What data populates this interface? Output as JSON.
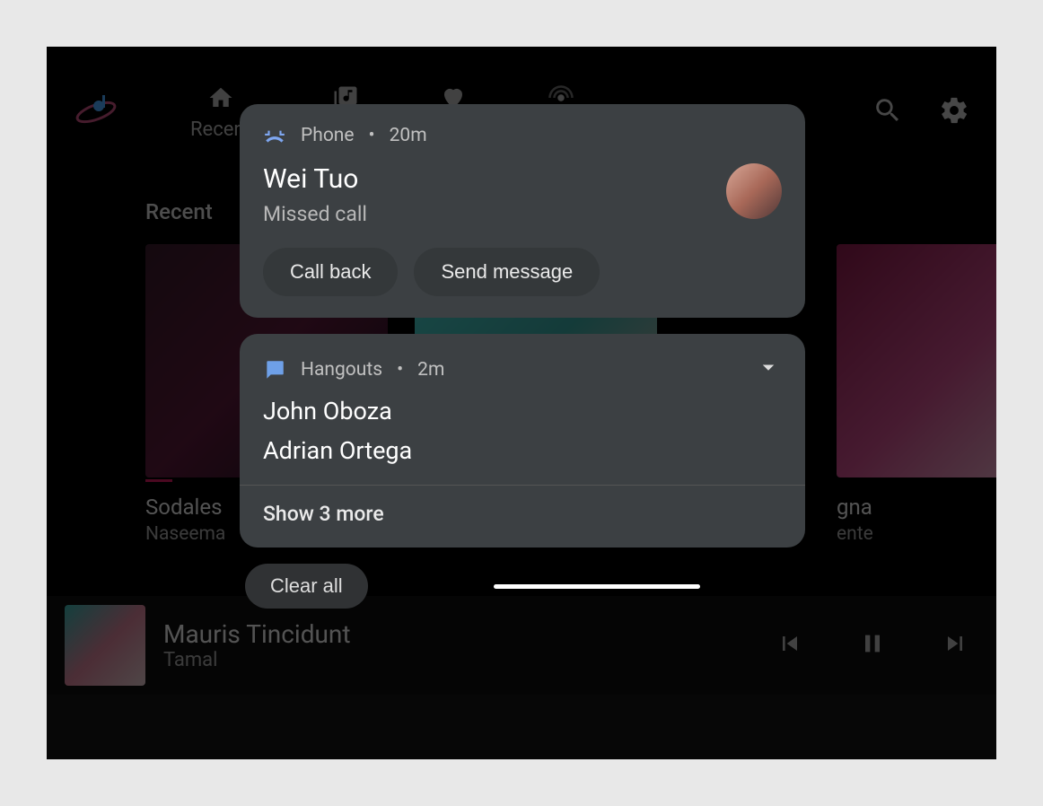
{
  "nav": {
    "tab_recent": "Recent"
  },
  "section": {
    "recent_title": "Recent"
  },
  "cards": [
    {
      "title": "Sodales",
      "subtitle": "Naseema"
    },
    {
      "title": "",
      "subtitle": ""
    },
    {
      "title": "gna",
      "subtitle": "ente"
    }
  ],
  "player": {
    "title": "Mauris Tincidunt",
    "subtitle": "Tamal"
  },
  "notifications": {
    "phone": {
      "app_label": "Phone",
      "time": "20m",
      "title": "Wei Tuo",
      "subtitle": "Missed call",
      "action_callback": "Call back",
      "action_message": "Send message"
    },
    "hangouts": {
      "app_label": "Hangouts",
      "time": "2m",
      "lines": [
        "John Oboza",
        "Adrian Ortega"
      ],
      "show_more": "Show 3 more"
    },
    "clear_all": "Clear all"
  }
}
